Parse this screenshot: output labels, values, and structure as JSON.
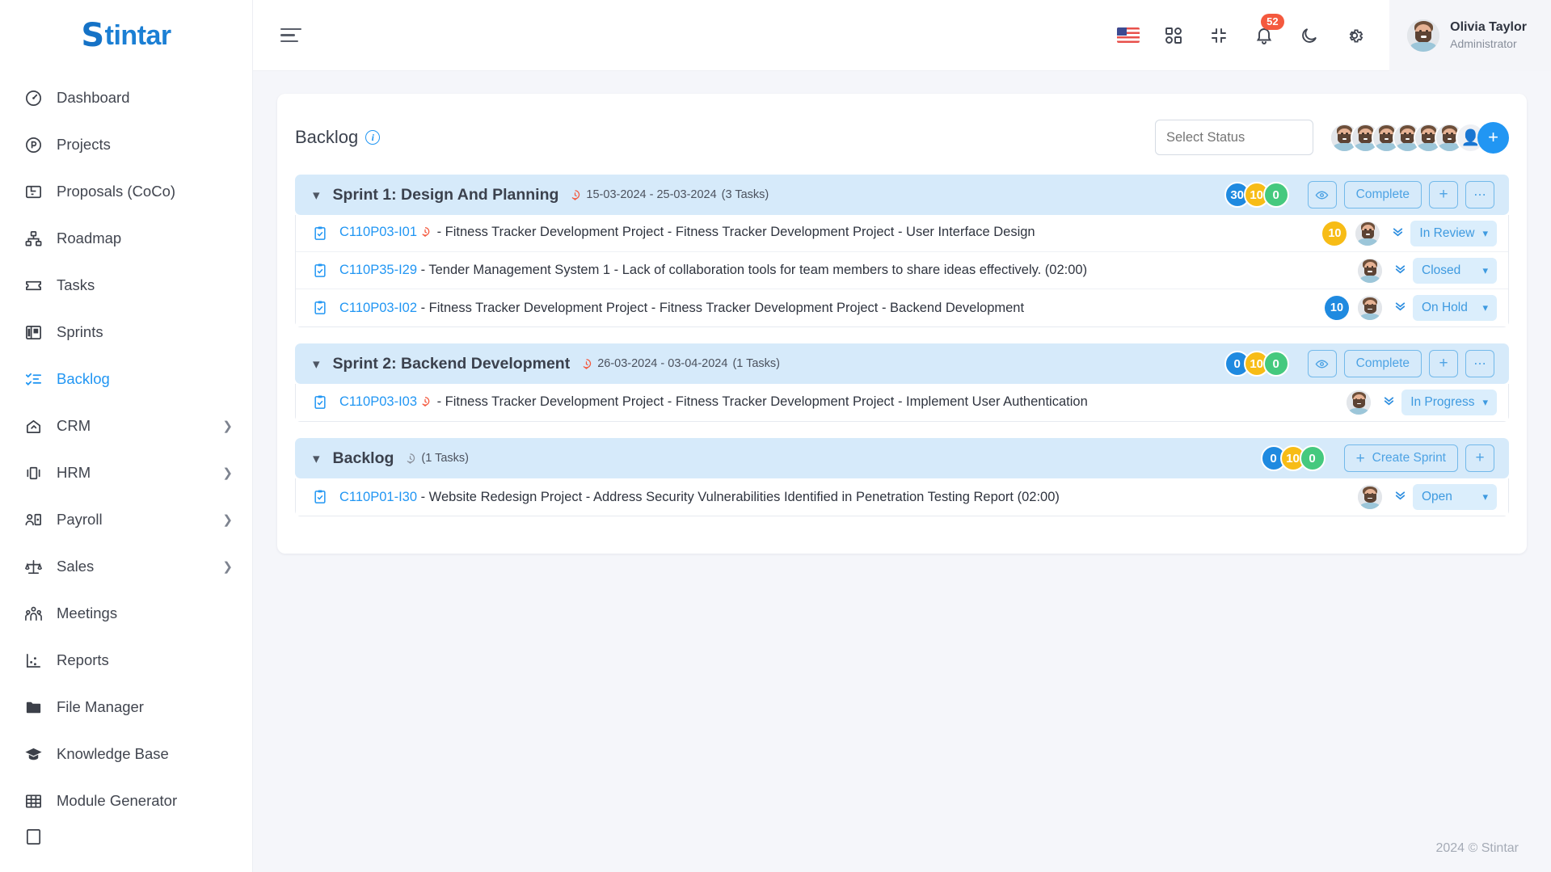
{
  "brand": {
    "s": "S",
    "rest": "tintar"
  },
  "sidebar": {
    "items": [
      {
        "label": "Dashboard",
        "icon": "dashboard-icon",
        "expandable": false,
        "active": false
      },
      {
        "label": "Projects",
        "icon": "projects-icon",
        "expandable": false,
        "active": false
      },
      {
        "label": "Proposals (CoCo)",
        "icon": "proposals-icon",
        "expandable": false,
        "active": false
      },
      {
        "label": "Roadmap",
        "icon": "roadmap-icon",
        "expandable": false,
        "active": false
      },
      {
        "label": "Tasks",
        "icon": "tasks-icon",
        "expandable": false,
        "active": false
      },
      {
        "label": "Sprints",
        "icon": "sprints-icon",
        "expandable": false,
        "active": false
      },
      {
        "label": "Backlog",
        "icon": "backlog-icon",
        "expandable": false,
        "active": true
      },
      {
        "label": "CRM",
        "icon": "crm-icon",
        "expandable": true,
        "active": false
      },
      {
        "label": "HRM",
        "icon": "hrm-icon",
        "expandable": true,
        "active": false
      },
      {
        "label": "Payroll",
        "icon": "payroll-icon",
        "expandable": true,
        "active": false
      },
      {
        "label": "Sales",
        "icon": "sales-icon",
        "expandable": true,
        "active": false
      },
      {
        "label": "Meetings",
        "icon": "meetings-icon",
        "expandable": false,
        "active": false
      },
      {
        "label": "Reports",
        "icon": "reports-icon",
        "expandable": false,
        "active": false
      },
      {
        "label": "File Manager",
        "icon": "folder-icon",
        "expandable": false,
        "active": false
      },
      {
        "label": "Knowledge Base",
        "icon": "graduation-cap-icon",
        "expandable": false,
        "active": false
      },
      {
        "label": "Module Generator",
        "icon": "grid-icon",
        "expandable": false,
        "active": false
      }
    ]
  },
  "topbar": {
    "menu_toggle": "menu-toggle",
    "language_flag": "US",
    "notification_count": "52",
    "user": {
      "name": "Olivia Taylor",
      "role": "Administrator"
    }
  },
  "page": {
    "title": "Backlog",
    "select_status_placeholder": "Select Status",
    "member_avatars": 6,
    "add_member_label": "+"
  },
  "groups": [
    {
      "title": "Sprint 1: Design And Planning",
      "dates": "15-03-2024 - 25-03-2024",
      "task_count_label": "(3 Tasks)",
      "clock_color": "#f4593e",
      "counters": [
        {
          "value": "30",
          "color": "#1f8ae0"
        },
        {
          "value": "10",
          "color": "#f7bc16"
        },
        {
          "value": "0",
          "color": "#45c97e"
        }
      ],
      "actions": {
        "view_label": "",
        "complete_label": "Complete",
        "add_label": "+",
        "more_label": "⋯"
      },
      "is_backlog": false,
      "tasks": [
        {
          "code": "C110P03-I01",
          "urgent": true,
          "text": " - Fitness Tracker Development Project - Fitness Tracker Development Project - User Interface Design",
          "points": "10",
          "points_color": "#f7bc16",
          "status": "In Review"
        },
        {
          "code": "C110P35-I29",
          "urgent": false,
          "text": " - Tender Management System 1 - Lack of collaboration tools for team members to share ideas effectively. (02:00)",
          "points": "",
          "points_color": "",
          "status": "Closed"
        },
        {
          "code": "C110P03-I02",
          "urgent": false,
          "text": " - Fitness Tracker Development Project - Fitness Tracker Development Project - Backend Development",
          "points": "10",
          "points_color": "#1f8ae0",
          "status": "On Hold"
        }
      ]
    },
    {
      "title": "Sprint 2: Backend Development",
      "dates": "26-03-2024 - 03-04-2024",
      "task_count_label": "(1 Tasks)",
      "clock_color": "#f4593e",
      "counters": [
        {
          "value": "0",
          "color": "#1f8ae0"
        },
        {
          "value": "10",
          "color": "#f7bc16"
        },
        {
          "value": "0",
          "color": "#45c97e"
        }
      ],
      "actions": {
        "view_label": "",
        "complete_label": "Complete",
        "add_label": "+",
        "more_label": "⋯"
      },
      "is_backlog": false,
      "tasks": [
        {
          "code": "C110P03-I03",
          "urgent": true,
          "text": " - Fitness Tracker Development Project - Fitness Tracker Development Project - Implement User Authentication",
          "points": "",
          "points_color": "",
          "status": "In Progress"
        }
      ]
    },
    {
      "title": "Backlog",
      "dates": "",
      "task_count_label": "(1 Tasks)",
      "clock_color": "#8d939e",
      "counters": [
        {
          "value": "0",
          "color": "#1f8ae0"
        },
        {
          "value": "10",
          "color": "#f7bc16"
        },
        {
          "value": "0",
          "color": "#45c97e"
        }
      ],
      "actions": {
        "create_sprint_label": "Create Sprint",
        "add_label": "+"
      },
      "is_backlog": true,
      "tasks": [
        {
          "code": "C110P01-I30",
          "urgent": false,
          "text": " - Website Redesign Project - Address Security Vulnerabilities Identified in Penetration Testing Report (02:00)",
          "points": "",
          "points_color": "",
          "status": "Open"
        }
      ]
    }
  ],
  "footer": {
    "copyright": "2024 © Stintar"
  }
}
